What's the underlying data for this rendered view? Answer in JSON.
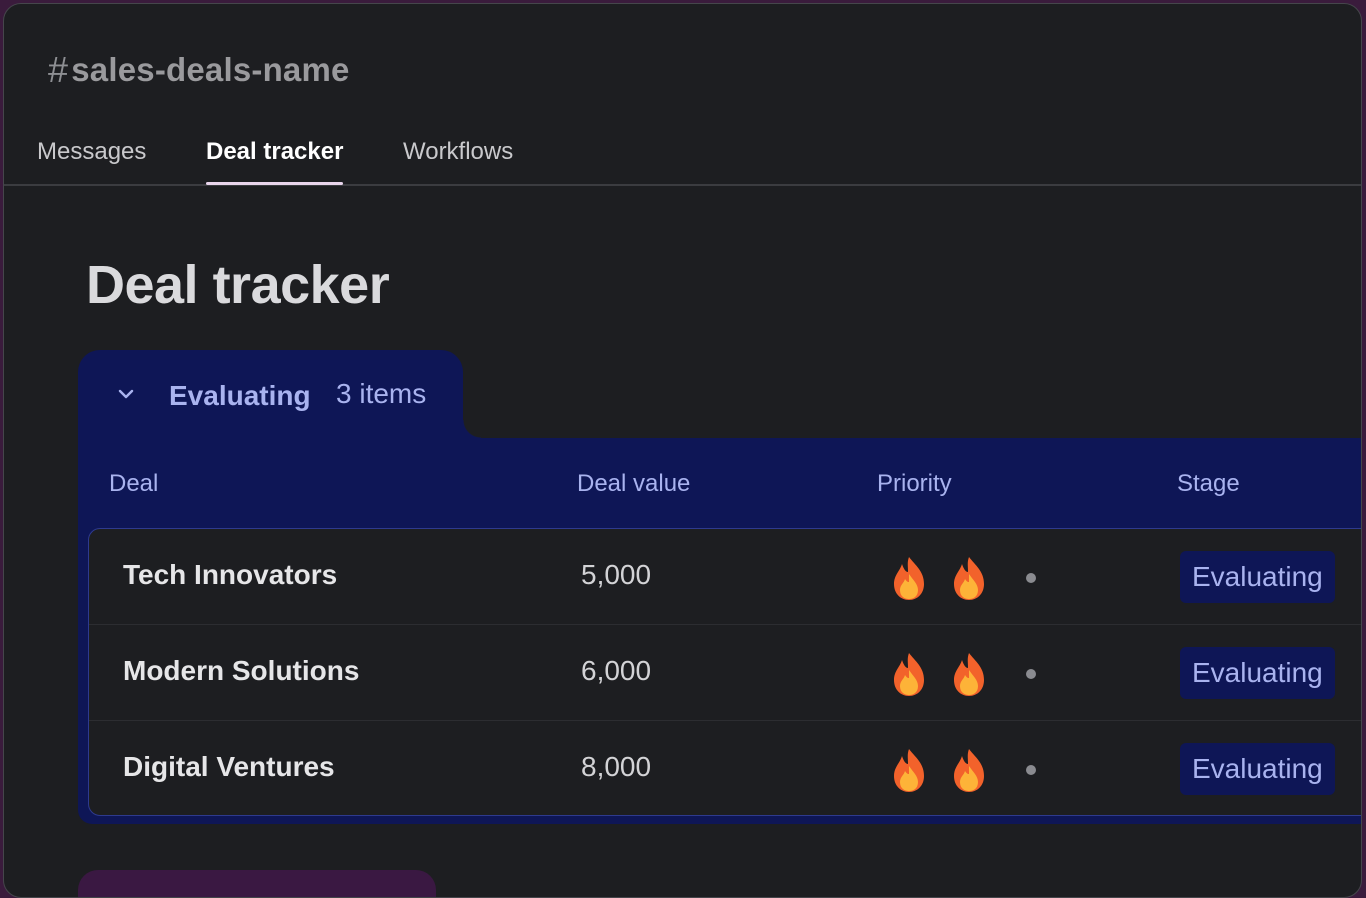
{
  "channel": {
    "hash": "#",
    "name": "sales-deals-name"
  },
  "tabs": [
    {
      "label": "Messages",
      "active": false
    },
    {
      "label": "Deal tracker",
      "active": true
    },
    {
      "label": "Workflows",
      "active": false
    }
  ],
  "page": {
    "title": "Deal tracker"
  },
  "group": {
    "name": "Evaluating",
    "count": "3 items",
    "columns": [
      "Deal",
      "Deal value",
      "Priority",
      "Stage"
    ],
    "rows": [
      {
        "deal": "Tech Innovators",
        "value": "5,000",
        "priority": 2,
        "stage": "Evaluating"
      },
      {
        "deal": "Modern Solutions",
        "value": "6,000",
        "priority": 2,
        "stage": "Evaluating"
      },
      {
        "deal": "Digital Ventures",
        "value": "8,000",
        "priority": 2,
        "stage": "Evaluating"
      }
    ]
  },
  "icons": {
    "collapse": "chevron-down-icon",
    "priority": "fire-icon",
    "priority_empty": "dot-icon"
  },
  "colors": {
    "group_accent": "#0e1656",
    "group_text": "#a9b3ef",
    "next_group": "#3a1842"
  }
}
